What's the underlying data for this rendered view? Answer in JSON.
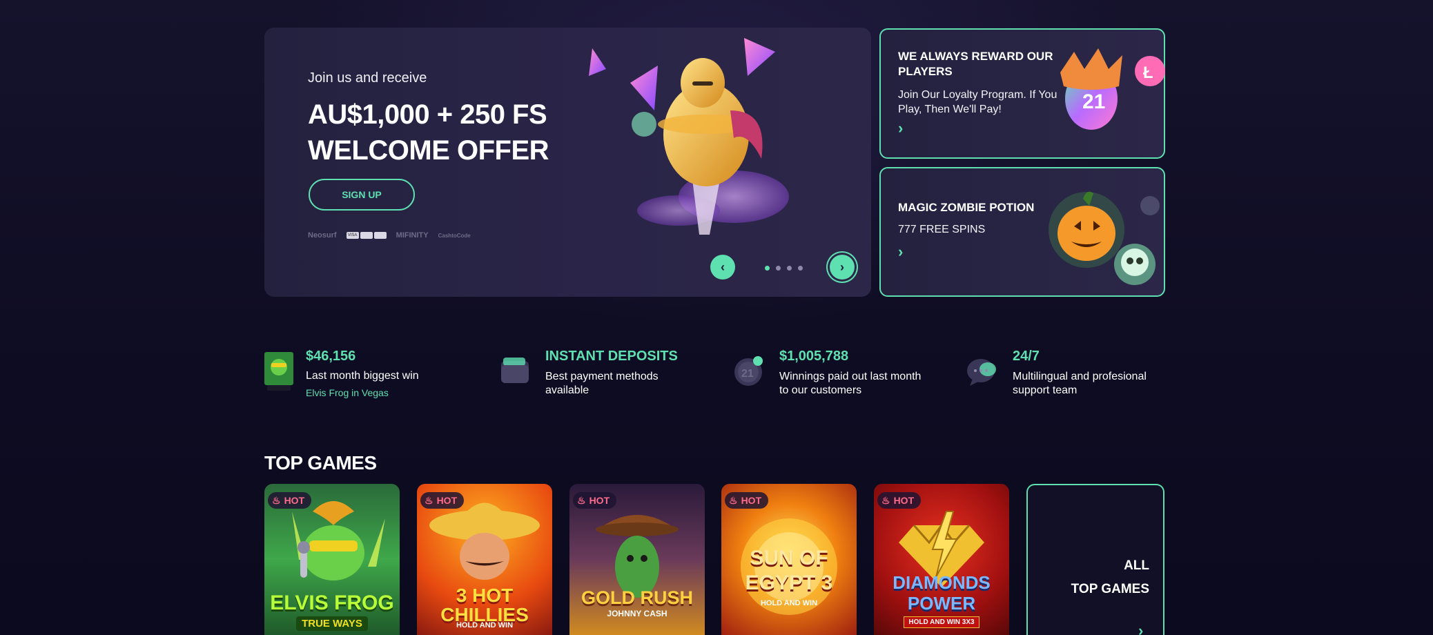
{
  "hero": {
    "subtitle": "Join us and receive",
    "title_line1": "AU$1,000 + 250 FS",
    "title_line2": "WELCOME OFFER",
    "signup_label": "SIGN UP",
    "payment_methods": [
      "Neosurf",
      "VISA",
      "MIFINITY",
      "CashtoCode"
    ],
    "carousel": {
      "slides": 4,
      "active_slide": 1
    }
  },
  "promos": [
    {
      "title": "WE ALWAYS REWARD OUR PLAYERS",
      "text": "Join Our Loyalty Program. If You Play, Then We'll Pay!",
      "badge_number": "21"
    },
    {
      "title": "MAGIC ZOMBIE POTION",
      "text": "777 FREE SPINS"
    }
  ],
  "stats": [
    {
      "value": "$46,156",
      "text": "Last month biggest win",
      "link": "Elvis Frog in Vegas"
    },
    {
      "value": "INSTANT DEPOSITS",
      "text": "Best payment methods available"
    },
    {
      "value": "$1,005,788",
      "text": "Winnings paid out last month to our customers"
    },
    {
      "value": "24/7",
      "text": "Multilingual and profesional support team"
    }
  ],
  "top_games": {
    "title": "TOP GAMES",
    "badge_label": "HOT",
    "games": [
      {
        "name": "ELVIS FROG",
        "tagline": "TRUE WAYS"
      },
      {
        "name": "3 HOT CHILLIES",
        "tagline": "HOLD AND WIN"
      },
      {
        "name": "GOLD RUSH",
        "tagline": "JOHNNY CASH"
      },
      {
        "name": "SUN OF EGYPT 3",
        "tagline": "HOLD AND WIN"
      },
      {
        "name": "DIAMONDS POWER",
        "tagline": "HOLD AND WIN 3X3"
      }
    ],
    "all_games_line1": "ALL",
    "all_games_line2": "TOP GAMES"
  },
  "colors": {
    "accent": "#5fe0b0",
    "background": "#0f0d24",
    "card": "#2a2548",
    "hot": "#ff6b8a"
  }
}
